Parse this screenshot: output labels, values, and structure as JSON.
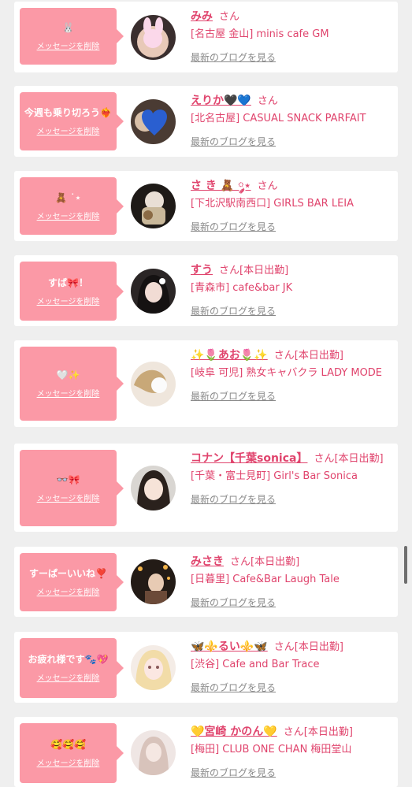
{
  "colors": {
    "accent": "#e0446d",
    "bubble": "#fb99a6",
    "link_gray": "#8a8a8a",
    "background": "#efefef"
  },
  "delete_label": "メッセージを削除",
  "blog_label": "最新のブログを見る",
  "items": [
    {
      "message": "🐰",
      "name": "みみ",
      "honorific": "さん",
      "status": "",
      "shop": "[名古屋 金山] minis cafe GM"
    },
    {
      "message": "今週も乗り切ろう❤️‍🔥",
      "name": "えりか🖤💙",
      "honorific": "さん",
      "status": "",
      "shop": "[北名古屋] CASUAL SNACK PARFAIT"
    },
    {
      "message": "🧸 ˙⋆",
      "name": "さ き 🧸 ༘⋆",
      "honorific": "さん",
      "status": "",
      "shop": "[下北沢駅南西口] GIRLS BAR LEIA"
    },
    {
      "message": "すば🎀！",
      "name": "すう",
      "honorific": "さん",
      "status": "[本日出勤]",
      "shop": "[青森市] cafe&bar JK"
    },
    {
      "message": "🤍✨",
      "name": "✨🌷あお🌷✨",
      "honorific": "さん",
      "status": "[本日出勤]",
      "shop": "[岐阜 可児] 熟女キャバクラ LADY MODE"
    },
    {
      "message": "👓🎀",
      "name": "コナン【千葉sonica】",
      "honorific": "さん",
      "status": "[本日出勤]",
      "shop": "[千葉・富士見町] Girl's Bar Sonica"
    },
    {
      "message": "すーぱーいいね❣️",
      "name": "みさき",
      "honorific": "さん",
      "status": "[本日出勤]",
      "shop": "[日暮里] Cafe&Bar Laugh Tale"
    },
    {
      "message": "お疲れ様です🐾💖",
      "name": "🦋⚜️るい⚜️🦋",
      "honorific": "さん",
      "status": "[本日出勤]",
      "shop": "[渋谷] Cafe and Bar Trace"
    },
    {
      "message": "🥰🥰🥰",
      "name": "💛宮崎 かのん💛",
      "honorific": "さん",
      "status": "[本日出勤]",
      "shop": "[梅田] CLUB ONE CHAN 梅田堂山"
    }
  ]
}
